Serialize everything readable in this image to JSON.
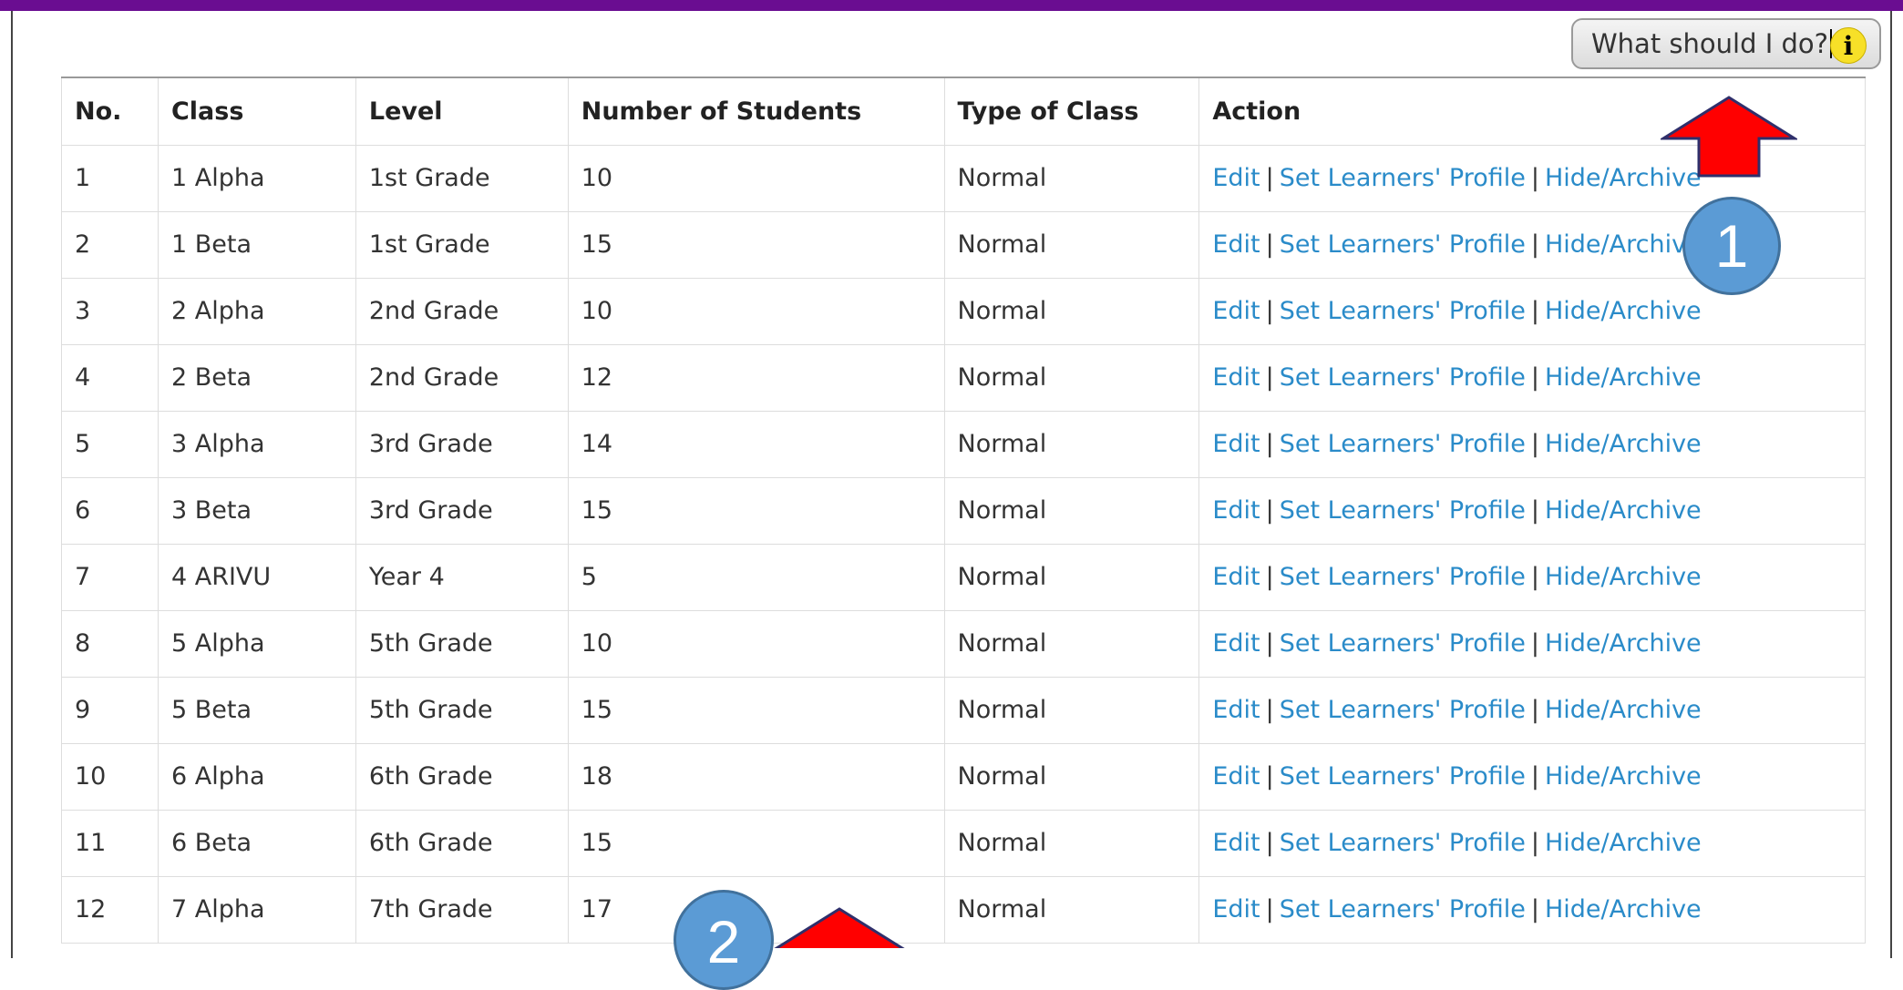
{
  "help": {
    "label": "What should I do?",
    "icon": "info-icon"
  },
  "table": {
    "headers": [
      "No.",
      "Class",
      "Level",
      "Number of Students",
      "Type of Class",
      "Action"
    ],
    "rows": [
      {
        "no": "1",
        "class": "1 Alpha",
        "level": "1st Grade",
        "students": "10",
        "type": "Normal"
      },
      {
        "no": "2",
        "class": "1 Beta",
        "level": "1st Grade",
        "students": "15",
        "type": "Normal"
      },
      {
        "no": "3",
        "class": "2 Alpha",
        "level": "2nd Grade",
        "students": "10",
        "type": "Normal"
      },
      {
        "no": "4",
        "class": "2 Beta",
        "level": "2nd Grade",
        "students": "12",
        "type": "Normal"
      },
      {
        "no": "5",
        "class": "3 Alpha",
        "level": "3rd Grade",
        "students": "14",
        "type": "Normal"
      },
      {
        "no": "6",
        "class": "3 Beta",
        "level": "3rd Grade",
        "students": "15",
        "type": "Normal"
      },
      {
        "no": "7",
        "class": "4 ARIVU",
        "level": "Year 4",
        "students": "5",
        "type": "Normal"
      },
      {
        "no": "8",
        "class": "5 Alpha",
        "level": "5th Grade",
        "students": "10",
        "type": "Normal"
      },
      {
        "no": "9",
        "class": "5 Beta",
        "level": "5th Grade",
        "students": "15",
        "type": "Normal"
      },
      {
        "no": "10",
        "class": "6 Alpha",
        "level": "6th Grade",
        "students": "18",
        "type": "Normal"
      },
      {
        "no": "11",
        "class": "6 Beta",
        "level": "6th Grade",
        "students": "15",
        "type": "Normal"
      },
      {
        "no": "12",
        "class": "7 Alpha",
        "level": "7th Grade",
        "students": "17",
        "type": "Normal"
      }
    ],
    "actions": {
      "edit": "Edit",
      "profile": "Set Learners' Profile",
      "archive": "Hide/Archive",
      "separator": "|"
    }
  },
  "annotations": {
    "badge_1": "1",
    "badge_2": "2",
    "arrow_color": "#ff0000",
    "badge_color": "#5b9bd5"
  },
  "colors": {
    "top_bar": "#6a0d91",
    "link": "#2a8bc9"
  }
}
